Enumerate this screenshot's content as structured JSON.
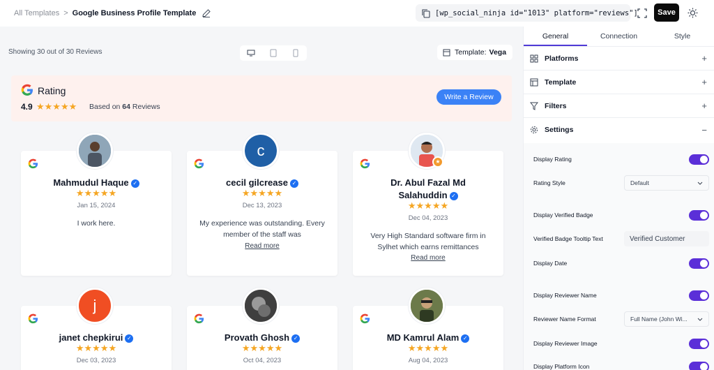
{
  "header": {
    "breadcrumb_parent": "All Templates",
    "breadcrumb_sep": ">",
    "breadcrumb_current": "Google Business Profile Template",
    "shortcode": "[wp_social_ninja id=\"1013\" platform=\"reviews\"]",
    "save_label": "Save"
  },
  "preview": {
    "showing_text": "Showing 30 out of 30 Reviews",
    "template_label": "Template:",
    "template_value": "Vega",
    "rating_title": "Rating",
    "rating_score": "4.9",
    "rating_stars": "★★★★★",
    "based_on_prefix": "Based on",
    "based_on_count": "64",
    "based_on_suffix": "Reviews",
    "write_review_label": "Write a Review"
  },
  "reviews": [
    {
      "name": "Mahmudul Haque",
      "stars": "★★★★★",
      "date": "Jan 15, 2024",
      "text": "I work here.",
      "read_more": ""
    },
    {
      "name": "cecil gilcrease",
      "stars": "★★★★★",
      "date": "Dec 13, 2023",
      "text": "My experience was outstanding. Every member of the staff was",
      "read_more": "Read more",
      "avatar_letter": "c",
      "avatar_color": "#1f5fa6"
    },
    {
      "name": "Dr. Abul Fazal Md Salahuddin",
      "stars": "★★★★★",
      "date": "Dec 04, 2023",
      "text": "Very High Standard software firm in Sylhet which earns remittances",
      "read_more": "Read more"
    },
    {
      "name": "janet chepkirui",
      "stars": "★★★★★",
      "date": "Dec 03, 2023",
      "avatar_letter": "j",
      "avatar_color": "#f04e23"
    },
    {
      "name": "Provath Ghosh",
      "stars": "★★★★★",
      "date": "Oct 04, 2023"
    },
    {
      "name": "MD Kamrul Alam",
      "stars": "★★★★★",
      "date": "Aug 04, 2023"
    }
  ],
  "panel": {
    "tabs": [
      "General",
      "Connection",
      "Style"
    ],
    "sections": [
      "Platforms",
      "Template",
      "Filters",
      "Settings"
    ],
    "settings": {
      "display_rating": "Display Rating",
      "rating_style": "Rating Style",
      "rating_style_value": "Default",
      "display_verified_badge": "Display Verified Badge",
      "verified_tooltip": "Verified Badge Tooltip Text",
      "verified_tooltip_value": "Verified Customer",
      "display_date": "Display Date",
      "display_reviewer_name": "Display Reviewer Name",
      "reviewer_name_format": "Reviewer Name Format",
      "reviewer_name_format_value": "Full Name (John Wi...",
      "display_reviewer_image": "Display Reviewer Image",
      "display_platform_icon": "Display Platform Icon"
    }
  },
  "colors": {
    "accent": "#5b2fd8",
    "button_blue": "#3b82f6",
    "star": "#f5a623"
  }
}
